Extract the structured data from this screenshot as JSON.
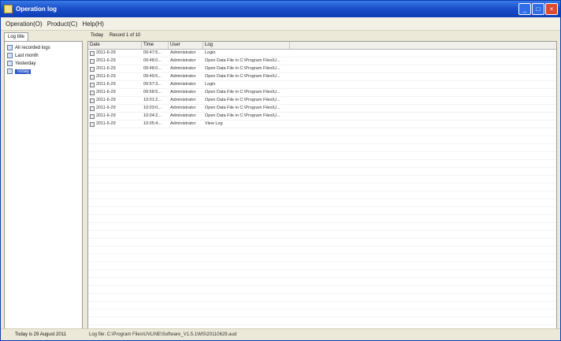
{
  "window": {
    "title": "Operation log"
  },
  "menu": [
    {
      "label": "Operation(O)"
    },
    {
      "label": "Product(C)"
    },
    {
      "label": "Help(H)"
    }
  ],
  "left": {
    "tab_label": "Log title",
    "tree": [
      {
        "label": "All recorded logs"
      },
      {
        "label": "Last month"
      },
      {
        "label": "Yesterday"
      },
      {
        "label": "Today",
        "selected": true
      }
    ]
  },
  "main": {
    "label": "Today",
    "record": "Record 1 of 10"
  },
  "table": {
    "columns": [
      "Date",
      "Time",
      "User",
      "Log"
    ],
    "rows": [
      [
        "2011-6-29",
        "09:47:5...",
        "Administrator",
        "Login"
      ],
      [
        "2011-6-29",
        "09:48:0...",
        "Administrator",
        "Open Data File in C:\\Program Files\\U..."
      ],
      [
        "2011-6-29",
        "09:48:0...",
        "Administrator",
        "Open Data File in C:\\Program Files\\U..."
      ],
      [
        "2011-6-29",
        "09:49:5...",
        "Administrator",
        "Open Data File in C:\\Program Files\\U..."
      ],
      [
        "2011-6-29",
        "09:57:3...",
        "Administrator",
        "Login"
      ],
      [
        "2011-6-29",
        "09:58:5...",
        "Administrator",
        "Open Data File in C:\\Program Files\\U..."
      ],
      [
        "2011-6-29",
        "10:01:2...",
        "Administrator",
        "Open Data File in C:\\Program Files\\U..."
      ],
      [
        "2011-6-29",
        "10:03:0...",
        "Administrator",
        "Open Data File in C:\\Program Files\\U..."
      ],
      [
        "2011-6-29",
        "10:04:2...",
        "Administrator",
        "Open Data File in C:\\Program Files\\U..."
      ],
      [
        "2011-6-29",
        "10:05:4...",
        "Administrator",
        "View Log"
      ]
    ]
  },
  "status": {
    "left": "Today is 29 August 2011",
    "right": "Log file: C:\\Program Files\\UVLINE\\Software_V1.5.1\\MS\\20110629.aud"
  }
}
